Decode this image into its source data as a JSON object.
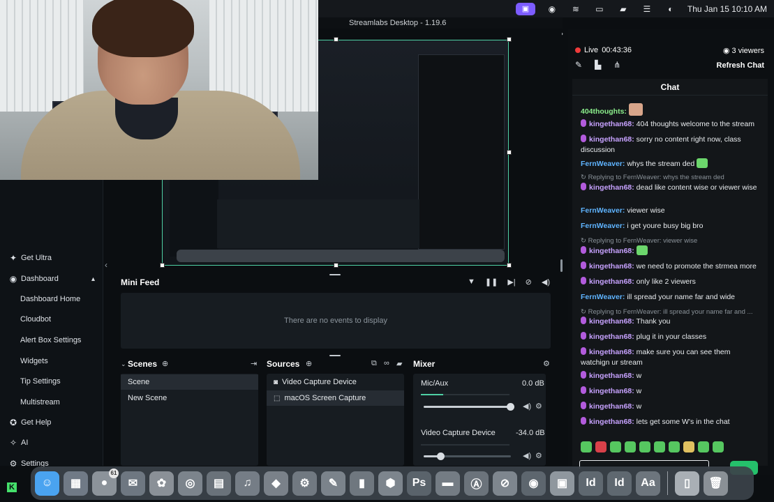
{
  "menubar": {
    "icons": [
      "streamlabs-icon",
      "screen-record-icon",
      "wifi-icon",
      "display-icon",
      "battery-icon",
      "control-center-icon",
      "siri-icon"
    ],
    "clock": "Thu Jan 15  10:10 AM"
  },
  "app": {
    "title": "Streamlabs Desktop - 1.19.6"
  },
  "sidebar": {
    "items": [
      {
        "label": "Get Ultra",
        "icon": "ultra-icon"
      },
      {
        "label": "Dashboard",
        "icon": "dashboard-icon"
      },
      {
        "label": "Dashboard Home"
      },
      {
        "label": "Cloudbot"
      },
      {
        "label": "Alert Box Settings"
      },
      {
        "label": "Widgets"
      },
      {
        "label": "Tip Settings"
      },
      {
        "label": "Multistream"
      },
      {
        "label": "Get Help",
        "icon": "help-icon"
      },
      {
        "label": "AI",
        "icon": "ai-icon"
      },
      {
        "label": "Settings",
        "icon": "settings-icon"
      }
    ]
  },
  "minifeed": {
    "title": "Mini Feed",
    "empty": "There are no events to display"
  },
  "scenes": {
    "title": "Scenes",
    "items": [
      {
        "label": "Scene",
        "selected": true
      },
      {
        "label": "New Scene",
        "selected": false
      }
    ]
  },
  "sources": {
    "title": "Sources",
    "items": [
      {
        "label": "Video Capture Device",
        "icon": "camera-icon",
        "selected": false
      },
      {
        "label": "macOS Screen Capture",
        "icon": "screen-capture-icon",
        "selected": true
      }
    ]
  },
  "mixer": {
    "title": "Mixer",
    "channels": [
      {
        "name": "Mic/Aux",
        "db": "0.0 dB",
        "meter": 0.25,
        "volume": 1.0
      },
      {
        "name": "Video Capture Device",
        "db": "-34.0 dB",
        "meter": 0.0,
        "volume": 0.2
      }
    ]
  },
  "live": {
    "status": "Live",
    "duration": "00:43:36",
    "viewers": "3 viewers",
    "refresh": "Refresh Chat"
  },
  "chat": {
    "title": "Chat",
    "messages": [
      {
        "user": "404thoughts:",
        "text": "",
        "color": "green",
        "badge": false,
        "emote": "face"
      },
      {
        "user": "kingethan68:",
        "text": " 404 thoughts welcome to the stream",
        "color": "purple",
        "badge": true
      },
      {
        "user": "kingethan68:",
        "text": " sorry no content right now, class discussion",
        "color": "purple",
        "badge": true
      },
      {
        "user": "FernWeaver:",
        "text": " whys the stream ded",
        "color": "blue",
        "badge": false,
        "emote": "green"
      },
      {
        "reply": "Replying to FernWeaver: whys the stream ded"
      },
      {
        "user": "kingethan68:",
        "text": " dead like content wise or viewer wise",
        "color": "purple",
        "badge": true
      },
      {
        "user": "FernWeaver:",
        "text": " viewer wise",
        "color": "blue",
        "badge": false
      },
      {
        "user": "FernWeaver:",
        "text": " i get youre busy big bro",
        "color": "blue",
        "badge": false
      },
      {
        "reply": "Replying to FernWeaver: viewer wise"
      },
      {
        "user": "kingethan68:",
        "text": "",
        "color": "purple",
        "badge": true,
        "emote": "green"
      },
      {
        "user": "kingethan68:",
        "text": " we need to promote the strmea more",
        "color": "purple",
        "badge": true
      },
      {
        "user": "kingethan68:",
        "text": " only like 2 viewers",
        "color": "purple",
        "badge": true
      },
      {
        "user": "FernWeaver:",
        "text": " ill spread your name far and wide",
        "color": "blue",
        "badge": false
      },
      {
        "reply": "Replying to FernWeaver: ill spread your name far and ..."
      },
      {
        "user": "kingethan68:",
        "text": " Thank you",
        "color": "purple",
        "badge": true
      },
      {
        "user": "kingethan68:",
        "text": " plug it in your classes",
        "color": "purple",
        "badge": true
      },
      {
        "user": "kingethan68:",
        "text": " make sure you can see them watchign ur stream",
        "color": "purple",
        "badge": true
      },
      {
        "user": "kingethan68:",
        "text": " w",
        "color": "purple",
        "badge": true
      },
      {
        "user": "kingethan68:",
        "text": " w",
        "color": "purple",
        "badge": true
      },
      {
        "user": "kingethan68:",
        "text": " w",
        "color": "purple",
        "badge": true
      },
      {
        "user": "kingethan68:",
        "text": " lets get some W's in the chat",
        "color": "purple",
        "badge": true
      }
    ]
  },
  "dock": {
    "apps": [
      {
        "name": "finder-icon",
        "glyph": "☺",
        "color": "#4aa3f0"
      },
      {
        "name": "launchpad-icon",
        "glyph": "▦",
        "color": "#707a86"
      },
      {
        "name": "messages-icon",
        "glyph": "●",
        "color": "#8c939a",
        "badge": "61"
      },
      {
        "name": "mail-icon",
        "glyph": "✉",
        "color": "#6e7781"
      },
      {
        "name": "photos-icon",
        "glyph": "✿",
        "color": "#8a9097"
      },
      {
        "name": "chrome-icon",
        "glyph": "◎",
        "color": "#7c848c"
      },
      {
        "name": "slideshow-icon",
        "glyph": "▤",
        "color": "#6a727a"
      },
      {
        "name": "music-icon",
        "glyph": "♫",
        "color": "#757d86"
      },
      {
        "name": "roblox-icon",
        "glyph": "◆",
        "color": "#7a8189"
      },
      {
        "name": "system-settings-icon",
        "glyph": "⚙",
        "color": "#717981"
      },
      {
        "name": "gimp-icon",
        "glyph": "✎",
        "color": "#7b838b"
      },
      {
        "name": "numbers-icon",
        "glyph": "▮",
        "color": "#6f777f"
      },
      {
        "name": "sketchup-icon",
        "glyph": "⬢",
        "color": "#7d858d"
      },
      {
        "name": "photoshop-icon",
        "glyph": "Ps",
        "color": "#5a636b"
      },
      {
        "name": "terminal-icon",
        "glyph": "▬",
        "color": "#747c84"
      },
      {
        "name": "accessibility-icon",
        "glyph": "Ⓐ",
        "color": "#6b737b"
      },
      {
        "name": "safari-icon",
        "glyph": "⊘",
        "color": "#7e868e"
      },
      {
        "name": "steam-icon",
        "glyph": "◉",
        "color": "#5d666e"
      },
      {
        "name": "streamlabs-icon",
        "glyph": "▣",
        "color": "#8f979e"
      },
      {
        "name": "indesign-icon",
        "glyph": "Id",
        "color": "#5f6870"
      },
      {
        "name": "indesign-2-icon",
        "glyph": "Id",
        "color": "#5f6870"
      },
      {
        "name": "font-book-icon",
        "glyph": "Aa",
        "color": "#6d757d"
      }
    ],
    "trailing": [
      {
        "name": "downloads-icon",
        "glyph": "▯",
        "color": "#a9afb5"
      },
      {
        "name": "trash-icon",
        "glyph": "🗑",
        "color": "#8a9096"
      }
    ]
  },
  "kick": {
    "logo": "K"
  }
}
